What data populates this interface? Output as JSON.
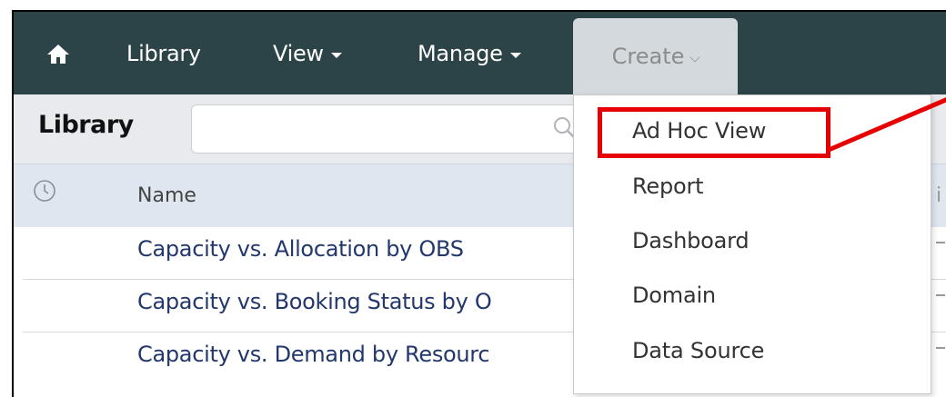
{
  "navbar": {
    "home_icon": "home-icon",
    "items": [
      {
        "label": "Library",
        "has_caret": false
      },
      {
        "label": "View",
        "has_caret": true
      },
      {
        "label": "Manage",
        "has_caret": true
      },
      {
        "label": "Create",
        "has_caret": true,
        "active": true
      }
    ]
  },
  "library": {
    "title": "Library",
    "search_value": "",
    "search_icon": "search-icon"
  },
  "table": {
    "columns": [
      "Name"
    ],
    "recent_icon": "clock-icon",
    "rows": [
      {
        "name": "Capacity vs. Allocation by OBS"
      },
      {
        "name": "Capacity vs. Booking Status by O"
      },
      {
        "name": "Capacity vs. Demand by Resourc"
      }
    ]
  },
  "create_menu": {
    "items": [
      {
        "label": "Ad Hoc View",
        "highlighted": true
      },
      {
        "label": "Report"
      },
      {
        "label": "Dashboard"
      },
      {
        "label": "Domain"
      },
      {
        "label": "Data Source"
      }
    ]
  },
  "colors": {
    "navbar_bg": "#2c4447",
    "active_tab_bg": "#d4d9dd",
    "link_color": "#22376b",
    "highlight": "#e60000"
  }
}
